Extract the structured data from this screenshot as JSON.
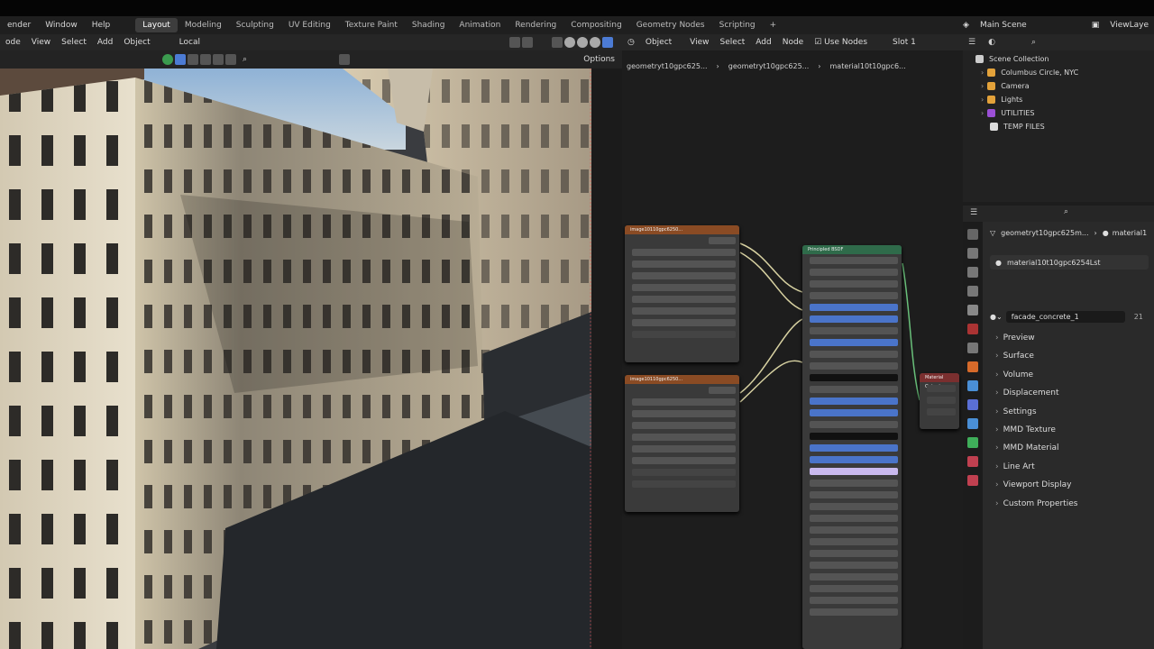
{
  "menu": {
    "items": [
      "ender",
      "Window",
      "Help"
    ]
  },
  "workspaces": {
    "tabs": [
      "Layout",
      "Modeling",
      "Sculpting",
      "UV Editing",
      "Texture Paint",
      "Shading",
      "Animation",
      "Rendering",
      "Compositing",
      "Geometry Nodes",
      "Scripting",
      "+"
    ],
    "active": "Layout"
  },
  "top_right": {
    "scene": "Main Scene",
    "view_layer": "ViewLaye"
  },
  "viewport": {
    "header": [
      "ode",
      "View",
      "Select",
      "Add",
      "Object"
    ],
    "orientation": "Local",
    "options_label": "Options"
  },
  "node_editor": {
    "header": {
      "object_mode": "Object",
      "view": "View",
      "select": "Select",
      "add": "Add",
      "node": "Node",
      "use_nodes": "Use Nodes",
      "slot": "Slot 1"
    },
    "breadcrumb": [
      "geometryt10gpc625...",
      "geometryt10gpc625...",
      "material10t10gpc6..."
    ],
    "nodes": [
      {
        "id": "img1",
        "title": "image10110gpc6250...",
        "colors": {
          "header": "#8a4b24"
        }
      },
      {
        "id": "img2",
        "title": "image10110gpc6250...",
        "colors": {
          "header": "#8a4b24"
        }
      },
      {
        "id": "bsdf",
        "title": "Principled BSDF",
        "colors": {
          "header": "#2f6b4a"
        }
      },
      {
        "id": "output",
        "title": "Material Output",
        "colors": {
          "header": "#7a2f2f"
        }
      }
    ]
  },
  "outliner": {
    "title": "Scene Collection",
    "items": [
      {
        "label": "Columbus Circle, NYC",
        "color": "#e3a23a"
      },
      {
        "label": "Camera",
        "color": "#e3a23a"
      },
      {
        "label": "Lights",
        "color": "#e3a23a"
      },
      {
        "label": "UTILITIES",
        "color": "#9b4fd6"
      },
      {
        "label": "TEMP FILES",
        "color": "#d8d8d8"
      }
    ]
  },
  "properties": {
    "breadcrumb_object": "geometryt10gpc625m...",
    "breadcrumb_material": "material1",
    "material_slot": "material10t10gpc6254Lst",
    "material_name": "facade_concrete_1",
    "user_count": "21",
    "panels": [
      "Preview",
      "Surface",
      "Volume",
      "Displacement",
      "Settings",
      "MMD Texture",
      "MMD Material",
      "Line Art",
      "Viewport Display",
      "Custom Properties"
    ]
  }
}
